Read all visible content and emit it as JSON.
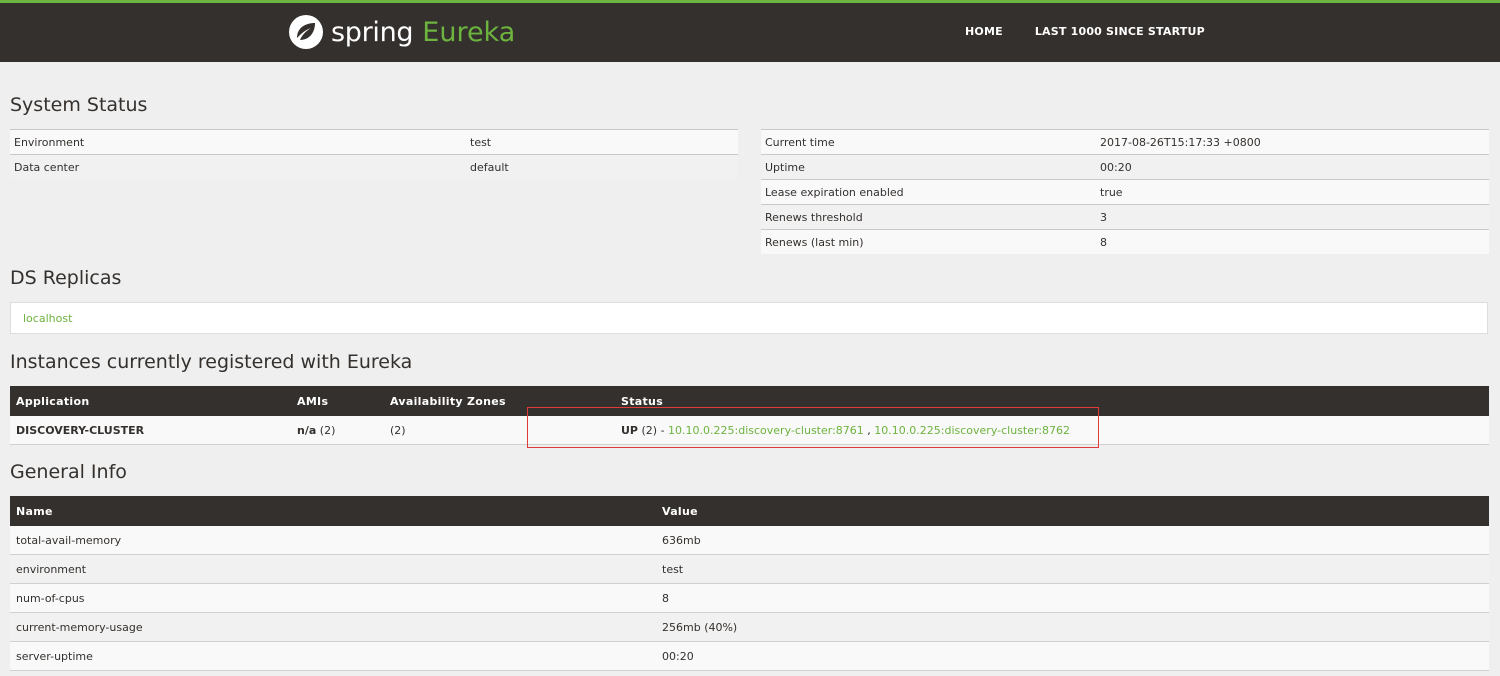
{
  "header": {
    "brand_spring": "spring",
    "brand_eureka": "Eureka",
    "nav": [
      {
        "label": "HOME"
      },
      {
        "label": "LAST 1000 SINCE STARTUP"
      }
    ]
  },
  "system_status": {
    "title": "System Status",
    "left": [
      {
        "key": "Environment",
        "value": "test"
      },
      {
        "key": "Data center",
        "value": "default"
      }
    ],
    "right": [
      {
        "key": "Current time",
        "value": "2017-08-26T15:17:33 +0800"
      },
      {
        "key": "Uptime",
        "value": "00:20"
      },
      {
        "key": "Lease expiration enabled",
        "value": "true"
      },
      {
        "key": "Renews threshold",
        "value": "3"
      },
      {
        "key": "Renews (last min)",
        "value": "8"
      }
    ]
  },
  "ds_replicas": {
    "title": "DS Replicas",
    "items": [
      "localhost"
    ]
  },
  "instances": {
    "title": "Instances currently registered with Eureka",
    "columns": [
      "Application",
      "AMIs",
      "Availability Zones",
      "Status"
    ],
    "rows": [
      {
        "application": "DISCOVERY-CLUSTER",
        "amis_bold": "n/a",
        "amis_count": "(2)",
        "zones": "(2)",
        "status_bold": "UP",
        "status_count": "(2) - ",
        "links": [
          "10.10.0.225:discovery-cluster:8761",
          "10.10.0.225:discovery-cluster:8762"
        ],
        "link_separator": " , "
      }
    ]
  },
  "general_info": {
    "title": "General Info",
    "columns": [
      "Name",
      "Value"
    ],
    "rows": [
      {
        "name": "total-avail-memory",
        "value": "636mb"
      },
      {
        "name": "environment",
        "value": "test"
      },
      {
        "name": "num-of-cpus",
        "value": "8"
      },
      {
        "name": "current-memory-usage",
        "value": "256mb (40%)"
      },
      {
        "name": "server-uptime",
        "value": "00:20"
      }
    ]
  },
  "colors": {
    "header_bg": "#34302d",
    "accent_green": "#6db33f",
    "page_bg": "#efefef",
    "highlight_red": "#e13a3a"
  }
}
